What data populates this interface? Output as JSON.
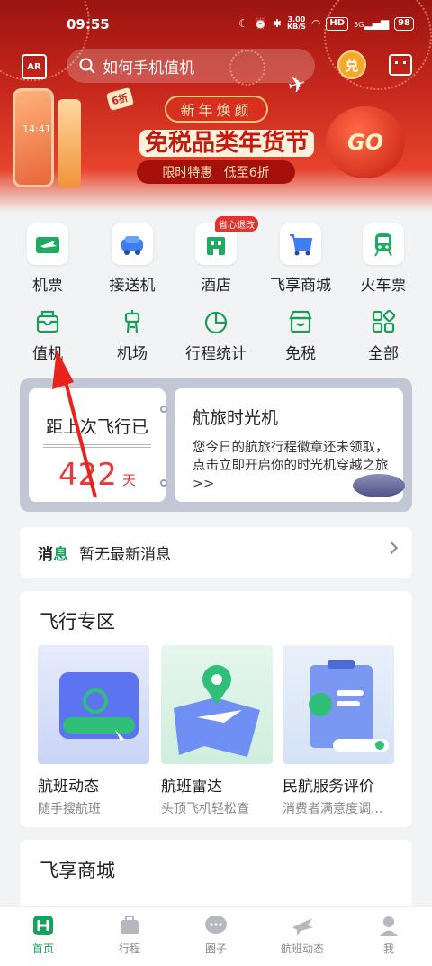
{
  "status_bar": {
    "time": "09:55",
    "speed_top": "3.00",
    "speed_unit": "KB/S",
    "hd": "HD",
    "net": "5G",
    "battery": "98"
  },
  "header": {
    "ar_label": "AR",
    "search_placeholder": "如何手机值机",
    "coin_label": "兑"
  },
  "banner": {
    "pill": "新年焕颜",
    "title": "免税品类年货节",
    "subtitle_a": "限时特惠",
    "subtitle_b": "低至6折",
    "lantern_text": "GO",
    "discount_tag": "6折",
    "phone_time": "14:41"
  },
  "services": [
    {
      "label": "机票"
    },
    {
      "label": "接送机"
    },
    {
      "label": "酒店",
      "badge": "省心退改"
    },
    {
      "label": "飞享商城"
    },
    {
      "label": "火车票"
    },
    {
      "label": "值机"
    },
    {
      "label": "机场"
    },
    {
      "label": "行程统计"
    },
    {
      "label": "免税"
    },
    {
      "label": "全部"
    }
  ],
  "time_machine": {
    "left_title": "距上次飞行已",
    "days": "422",
    "days_unit": "天",
    "right_title": "航旅时光机",
    "right_desc": "您今日的航旅行程徽章还未领取，点击立即开启你的时光机穿越之旅 >>"
  },
  "message": {
    "label_a": "消",
    "label_b": "息",
    "text": "暂无最新消息"
  },
  "flight_zone": {
    "title": "飞行专区",
    "cards": [
      {
        "name": "航班动态",
        "sub": "随手搜航班"
      },
      {
        "name": "航班雷达",
        "sub": "头顶飞机轻松查"
      },
      {
        "name": "民航服务评价",
        "sub": "消费者满意度调..."
      }
    ]
  },
  "shop": {
    "title": "飞享商城"
  },
  "tabbar": [
    {
      "label": "首页"
    },
    {
      "label": "行程"
    },
    {
      "label": "圈子"
    },
    {
      "label": "航班动态"
    },
    {
      "label": "我"
    }
  ],
  "colors": {
    "brand_green": "#19a05c",
    "accent_red": "#e83a3a",
    "banner_red": "#c4261b"
  }
}
